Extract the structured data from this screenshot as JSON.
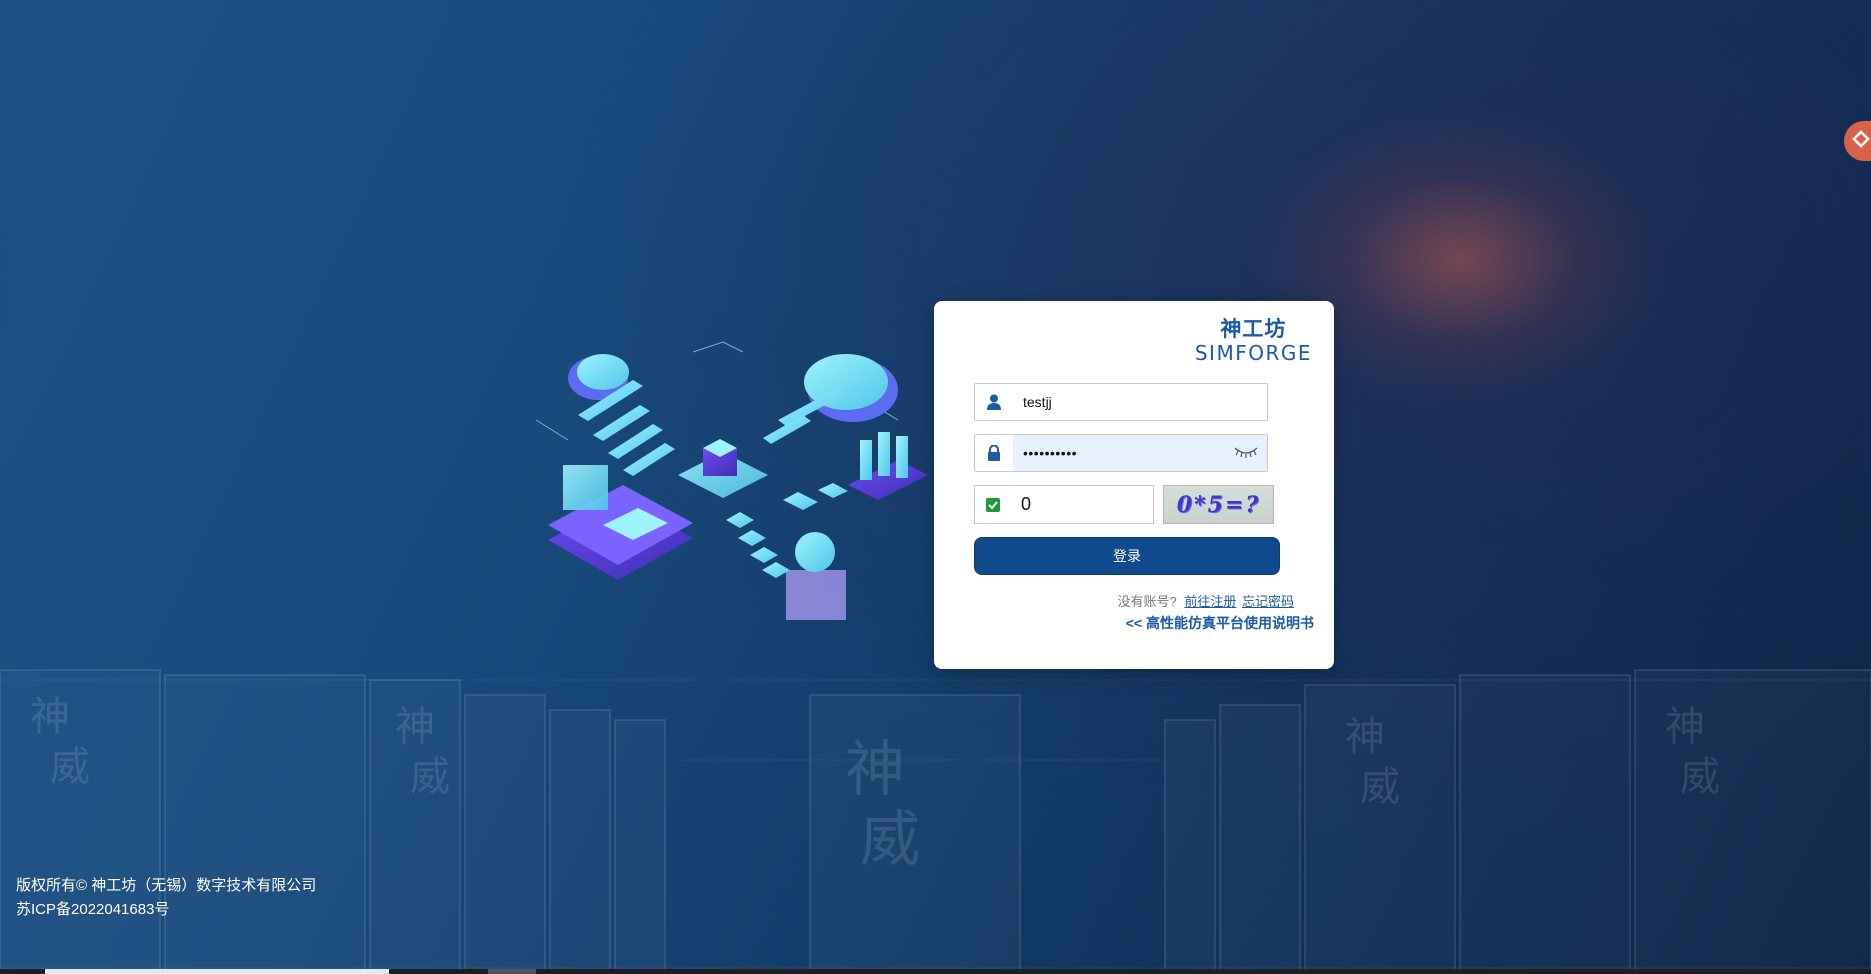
{
  "brand": {
    "name_cn": "神工坊",
    "name_en": "SIMFORGE"
  },
  "login": {
    "username_value": "testjj",
    "password_value": "••••••••••",
    "captcha_value": "0",
    "captcha_image_text": "0*5=?",
    "submit_label": "登录",
    "no_account_text": "没有账号?",
    "register_link": "前往注册",
    "forgot_link": "忘记密码",
    "manual_link": "<< 高性能仿真平台使用说明书"
  },
  "backdrop": {
    "cabinet_glyph_a": "神",
    "cabinet_glyph_b": "威"
  },
  "footer": {
    "copyright": "版权所有© 神工坊（无锡）数字技术有限公司",
    "icp": "苏ICP备2022041683号"
  },
  "icons": [
    "user-icon",
    "lock-icon",
    "eye-closed-icon",
    "check-icon",
    "side-widget-icon"
  ],
  "colors": {
    "primary": "#0e4a8c",
    "brand": "#1c5aa6",
    "bg_dark": "#0e2e55"
  }
}
